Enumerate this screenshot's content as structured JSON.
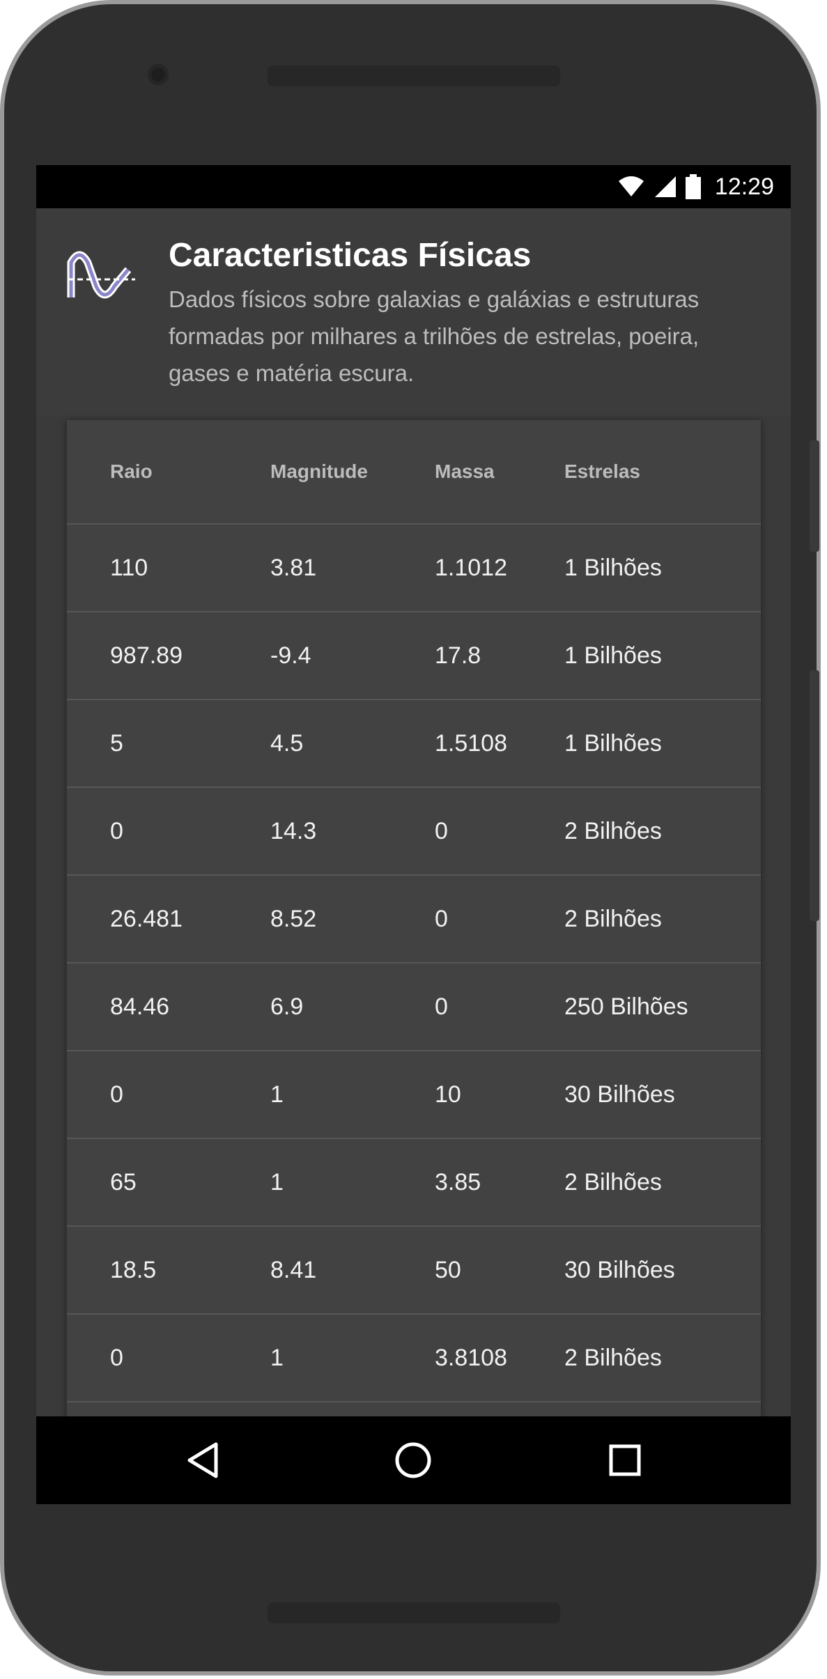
{
  "status_bar": {
    "time": "12:29",
    "icons": [
      "wifi-icon",
      "signal-icon",
      "battery-icon"
    ]
  },
  "header": {
    "title": "Caracteristicas Físicas",
    "subtitle": "Dados físicos sobre galaxias e galáxias e estruturas formadas por milhares a trilhões de estrelas, poeira, gases e matéria escura.",
    "icon": "sine-wave-icon"
  },
  "table": {
    "columns": [
      "Raio",
      "Magnitude",
      "Massa",
      "Estrelas"
    ],
    "rows": [
      [
        "110",
        "3.81",
        "1.1012",
        "1 Bilhões"
      ],
      [
        "987.89",
        "-9.4",
        "17.8",
        "1 Bilhões"
      ],
      [
        "5",
        "4.5",
        "1.5108",
        "1 Bilhões"
      ],
      [
        "0",
        "14.3",
        "0",
        "2 Bilhões"
      ],
      [
        "26.481",
        "8.52",
        "0",
        "2 Bilhões"
      ],
      [
        "84.46",
        "6.9",
        "0",
        "250 Bilhões"
      ],
      [
        "0",
        "1",
        "10",
        "30 Bilhões"
      ],
      [
        "65",
        "1",
        "3.85",
        "2 Bilhões"
      ],
      [
        "18.5",
        "8.41",
        "50",
        "30 Bilhões"
      ],
      [
        "0",
        "1",
        "3.8108",
        "2 Bilhões"
      ]
    ]
  },
  "navbar": {
    "buttons": [
      "back-icon",
      "home-icon",
      "recents-icon"
    ]
  },
  "colors": {
    "screen_bg": "#3a3a3a",
    "card_bg": "#424242",
    "accent_icon": "#8a86c9"
  }
}
